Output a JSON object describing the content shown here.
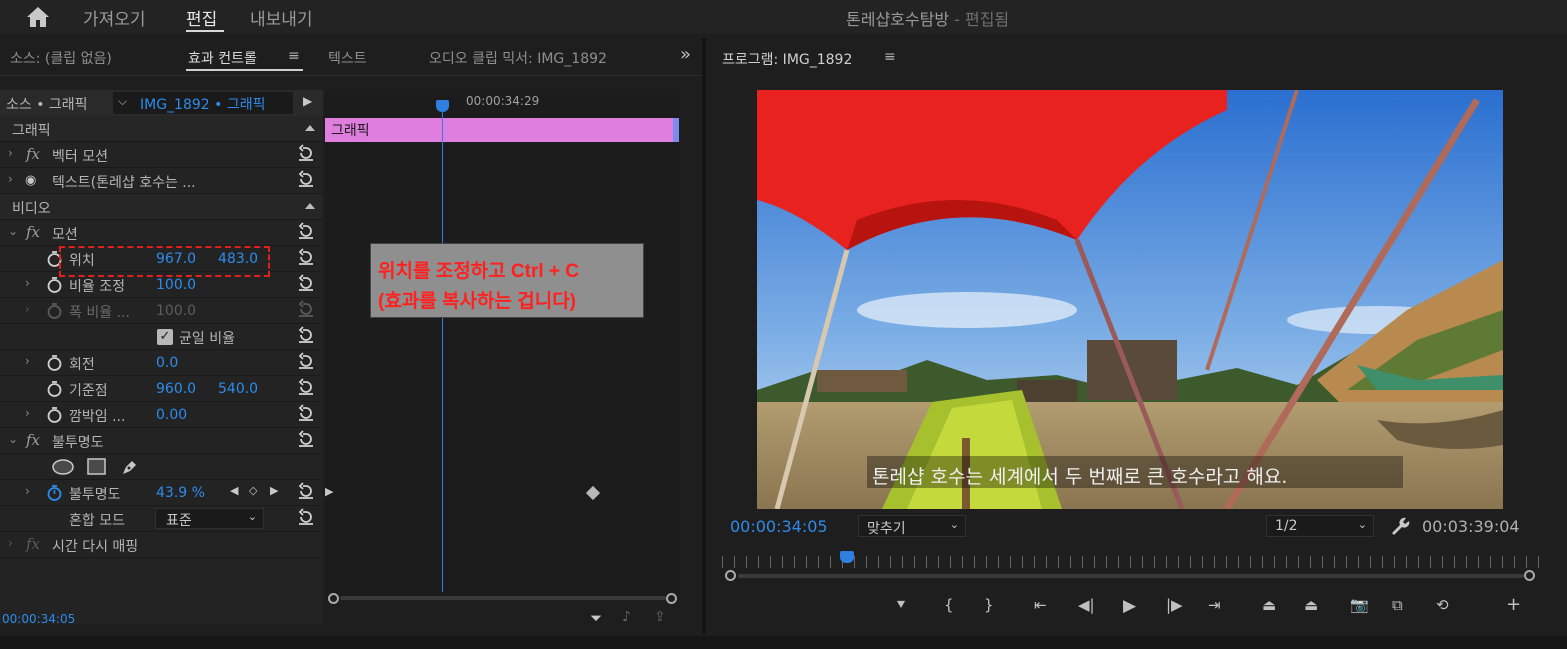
{
  "topbar": {
    "nav": [
      "가져오기",
      "편집",
      "내보내기"
    ],
    "active": "편집",
    "title": "톤레샵호수탐방",
    "title_sub": " - 편집됨"
  },
  "left_tabs": {
    "source": "소스: (클립 없음)",
    "effect_controls": "효과 컨트롤",
    "text": "텍스트",
    "audio_mixer": "오디오 클립 믹서: IMG_1892",
    "overflow": "»"
  },
  "ec_header": {
    "source_label": "소스 • 그래픽",
    "clip_label": "IMG_1892 • 그래픽",
    "timecode_ruler": "00:00:34:29",
    "clip_bar_label": "그래픽"
  },
  "ec_rows": {
    "graphic": "그래픽",
    "vector_motion": "벡터 모션",
    "text_layer": "텍스트(톤레샵 호수는 ...",
    "video": "비디오",
    "motion": "모션",
    "position": "위치",
    "position_x": "967.0",
    "position_y": "483.0",
    "scale": "비율 조정",
    "scale_val": "100.0",
    "scale_width": "폭 비율 ...",
    "scale_width_val": "100.0",
    "uniform_scale": "균일 비율",
    "rotation": "회전",
    "rotation_val": "0.0",
    "anchor": "기준점",
    "anchor_x": "960.0",
    "anchor_y": "540.0",
    "antiflicker": "깜박임 ...",
    "antiflicker_val": "0.00",
    "opacity_group": "불투명도",
    "opacity": "불투명도",
    "opacity_val": "43.9 %",
    "blend_mode": "혼합 모드",
    "blend_mode_val": "표준",
    "time_remap": "시간 다시 매핑"
  },
  "ec_footer_timecode": "00:00:34:05",
  "callout": {
    "line1": "위치를 조정하고 Ctrl + C",
    "line2": "(효과를 복사하는 겁니다)"
  },
  "program": {
    "tab": "프로그램: IMG_1892",
    "timecode": "00:00:34:05",
    "fit": "맞추기",
    "resolution": "1/2",
    "duration": "00:03:39:04",
    "subtitle": "톤레샵 호수는 세계에서 두 번째로 큰 호수라고 해요."
  },
  "colors": {
    "accent_blue": "#2d8ceb",
    "clip_pink": "#e07ee0",
    "callout_red": "#ff2020",
    "canopy_red": "#e8231f"
  }
}
